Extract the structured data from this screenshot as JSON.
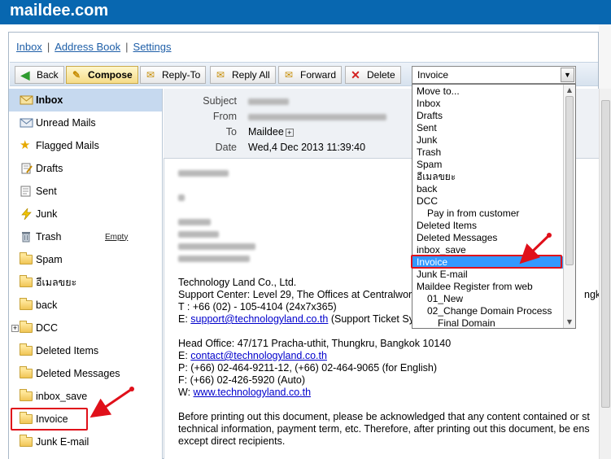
{
  "brand": "maildee.com",
  "topnav": {
    "inbox": "Inbox",
    "address_book": "Address Book",
    "settings": "Settings",
    "separator": "|"
  },
  "toolbar": {
    "back": "Back",
    "compose": "Compose",
    "reply_to": "Reply-To",
    "reply_all": "Reply All",
    "forward": "Forward",
    "delete": "Delete"
  },
  "move_select": {
    "selected": "Invoice"
  },
  "dropdown_options": [
    "Move to...",
    "Inbox",
    "Drafts",
    "Sent",
    "Junk",
    "Trash",
    "Spam",
    "อีเมลขยะ",
    "back",
    "DCC",
    "Pay in from customer",
    "Deleted Items",
    "Deleted Messages",
    "inbox_save",
    "Invoice",
    "Junk E-mail",
    "Maildee Register from web",
    "01_New",
    "02_Change Domain Process",
    "Final Domain"
  ],
  "folders": [
    {
      "label": "Inbox",
      "icon": "inbox-icon"
    },
    {
      "label": "Unread Mails",
      "icon": "envelope-icon"
    },
    {
      "label": "Flagged Mails",
      "icon": "star-icon"
    },
    {
      "label": "Drafts",
      "icon": "draft-icon"
    },
    {
      "label": "Sent",
      "icon": "sent-icon"
    },
    {
      "label": "Junk",
      "icon": "lightning-icon"
    },
    {
      "label": "Trash",
      "icon": "trash-icon",
      "action": "Empty"
    },
    {
      "label": "Spam",
      "icon": "folder-icon"
    },
    {
      "label": "อีเมลขยะ",
      "icon": "folder-icon"
    },
    {
      "label": "back",
      "icon": "folder-icon"
    },
    {
      "label": "DCC",
      "icon": "folder-icon"
    },
    {
      "label": "Deleted Items",
      "icon": "folder-icon"
    },
    {
      "label": "Deleted Messages",
      "icon": "folder-icon"
    },
    {
      "label": "inbox_save",
      "icon": "folder-icon"
    },
    {
      "label": "Invoice",
      "icon": "folder-icon"
    },
    {
      "label": "Junk E-mail",
      "icon": "folder-icon"
    }
  ],
  "message": {
    "subject_label": "Subject",
    "from_label": "From",
    "to_label": "To",
    "to_value": "Maildee",
    "date_label": "Date",
    "date_value": "Wed,4 Dec 2013 11:39:40",
    "body": {
      "company": "Technology Land Co., Ltd.",
      "support_center": "Support Center: Level 29, The Offices at Centralworld",
      "support_center_end": "ngkok",
      "tel": "T : +66 (02) - 105-4104 (24x7x365)",
      "email_prefix": "E: ",
      "support_email": "support@technologyland.co.th",
      "support_ticket": " (Support Ticket Sy",
      "head_office": "Head Office: 47/171 Pracha-uthit, Thungkru, Bangkok 10140",
      "contact_email": "contact@technologyland.co.th",
      "phone": "P: (+66) 02-464-9211-12, (+66) 02-464-9065 (for English)",
      "fax": "F: (+66) 02-426-5920  (Auto)",
      "web_prefix": "W: ",
      "website": "www.technologyland.co.th",
      "disclaimer1": "Before printing out this document, please be acknowledged that any content contained or st",
      "disclaimer2": "technical information, payment term, etc. Therefore, after printing out this document, be ens",
      "disclaimer3": "except direct recipients."
    }
  },
  "colors": {
    "brand_bar": "#0867b0",
    "selected_folder": "#c6d9ef",
    "highlight_option": "#3399ff",
    "annotation_red": "#e0101a"
  }
}
